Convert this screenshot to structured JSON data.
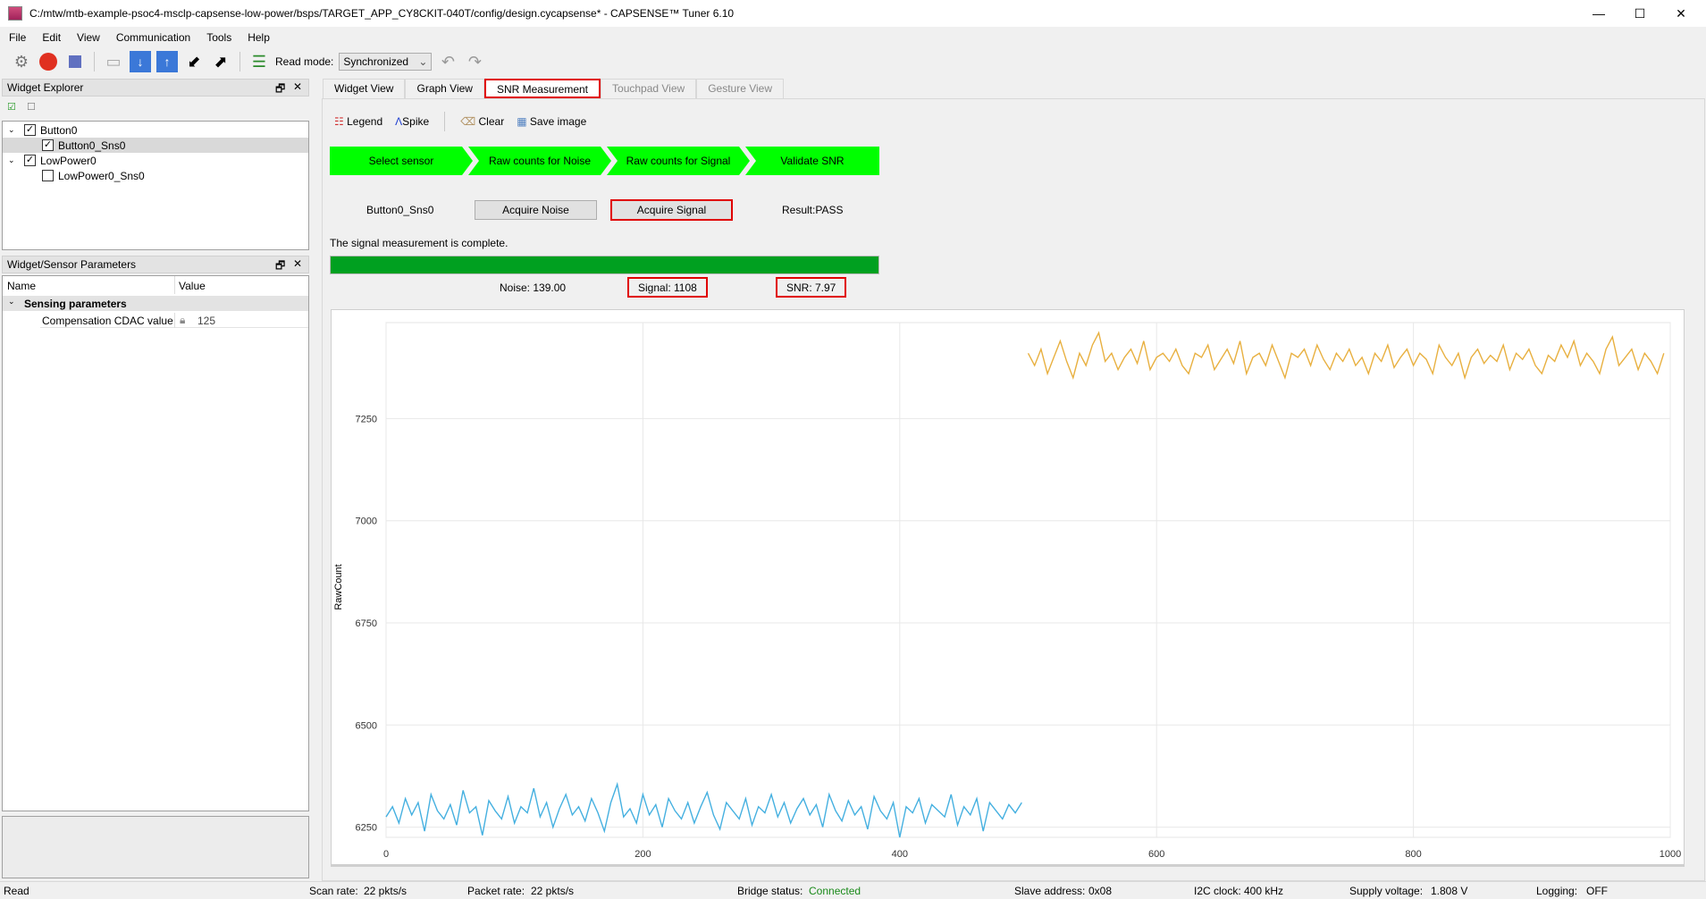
{
  "window": {
    "title": "C:/mtw/mtb-example-psoc4-msclp-capsense-low-power/bsps/TARGET_APP_CY8CKIT-040T/config/design.cycapsense* - CAPSENSE™ Tuner 6.10",
    "minimize": "—",
    "maximize": "☐",
    "close": "✕"
  },
  "menu": [
    "File",
    "Edit",
    "View",
    "Communication",
    "Tools",
    "Help"
  ],
  "toolbar": {
    "read_mode_label": "Read mode:",
    "read_mode_value": "Synchronized",
    "icons": [
      "gear-icon",
      "disconnect-icon",
      "stop-icon",
      "open-icon",
      "download-icon",
      "upload-icon",
      "import-icon",
      "export-icon",
      "log-icon",
      "undo-icon",
      "redo-icon"
    ]
  },
  "widget_explorer": {
    "title": "Widget Explorer",
    "tree": [
      {
        "label": "Button0",
        "checked": true,
        "level": 0
      },
      {
        "label": "Button0_Sns0",
        "checked": true,
        "level": 1,
        "selected": true
      },
      {
        "label": "LowPower0",
        "checked": true,
        "level": 0
      },
      {
        "label": "LowPower0_Sns0",
        "checked": false,
        "level": 1
      }
    ]
  },
  "params": {
    "title": "Widget/Sensor Parameters",
    "col_name": "Name",
    "col_value": "Value",
    "group": "Sensing parameters",
    "row_name": "Compensation CDAC value",
    "row_value": "125"
  },
  "tabs": [
    {
      "label": "Widget View"
    },
    {
      "label": "Graph View"
    },
    {
      "label": "SNR Measurement",
      "selected": true
    },
    {
      "label": "Touchpad View",
      "disabled": true
    },
    {
      "label": "Gesture View",
      "disabled": true
    }
  ],
  "snr_toolbar": {
    "legend": "Legend",
    "spike": "Spike",
    "clear": "Clear",
    "save_image": "Save image"
  },
  "steps": [
    "Select sensor",
    "Raw counts for Noise",
    "Raw counts for Signal",
    "Validate SNR"
  ],
  "sensor": "Button0_Sns0",
  "acquire_noise": "Acquire Noise",
  "acquire_signal": "Acquire Signal",
  "result": "Result:PASS",
  "message": "The signal measurement is complete.",
  "progress": 100,
  "noise": "Noise:  139.00",
  "signal": "Signal:  1108",
  "snr": "SNR:  7.97",
  "colors": {
    "step": "#00ff00",
    "progress": "#00a020",
    "noise_series": "#45b0e0",
    "signal_series": "#e8b040",
    "highlight": "#e00000"
  },
  "chart_data": {
    "type": "line",
    "ylabel": "RawCount",
    "xlim": [
      0,
      1000
    ],
    "ylim": [
      6225,
      7485
    ],
    "grid": true,
    "xticks": [
      "0",
      "200",
      "400",
      "600",
      "800",
      "1000"
    ],
    "yticks": [
      "6250",
      "6500",
      "6750",
      "7000",
      "7250"
    ],
    "series": [
      {
        "x_start": 0,
        "x_step": 5,
        "values": [
          6275,
          6300,
          6260,
          6320,
          6280,
          6310,
          6240,
          6330,
          6290,
          6270,
          6305,
          6255,
          6340,
          6285,
          6300,
          6230,
          6315,
          6290,
          6270,
          6325,
          6260,
          6300,
          6285,
          6345,
          6275,
          6310,
          6250,
          6295,
          6330,
          6280,
          6300,
          6265,
          6320,
          6285,
          6240,
          6310,
          6355,
          6275,
          6295,
          6260,
          6330,
          6280,
          6305,
          6250,
          6320,
          6290,
          6270,
          6310,
          6260,
          6300,
          6335,
          6280,
          6245,
          6310,
          6290,
          6270,
          6320,
          6255,
          6300,
          6285,
          6330,
          6275,
          6310,
          6260,
          6295,
          6320,
          6280,
          6305,
          6250,
          6330,
          6290,
          6265,
          6315,
          6280,
          6300,
          6245,
          6325,
          6290,
          6270,
          6310,
          6225,
          6300,
          6285,
          6320,
          6260,
          6305,
          6290,
          6275,
          6330,
          6255,
          6300,
          6280,
          6320,
          6240,
          6310,
          6290,
          6270,
          6305,
          6285,
          6310
        ]
      },
      {
        "x_start": 500,
        "x_step": 5,
        "values": [
          7410,
          7380,
          7420,
          7360,
          7400,
          7440,
          7390,
          7350,
          7410,
          7380,
          7430,
          7460,
          7390,
          7410,
          7370,
          7400,
          7420,
          7385,
          7440,
          7370,
          7400,
          7410,
          7390,
          7420,
          7380,
          7360,
          7410,
          7400,
          7430,
          7370,
          7395,
          7420,
          7385,
          7440,
          7360,
          7400,
          7410,
          7380,
          7430,
          7390,
          7350,
          7410,
          7400,
          7420,
          7380,
          7430,
          7395,
          7370,
          7410,
          7390,
          7420,
          7380,
          7400,
          7360,
          7410,
          7390,
          7430,
          7375,
          7400,
          7420,
          7380,
          7410,
          7395,
          7360,
          7430,
          7400,
          7380,
          7410,
          7350,
          7400,
          7420,
          7385,
          7405,
          7390,
          7430,
          7370,
          7410,
          7395,
          7420,
          7380,
          7360,
          7405,
          7390,
          7430,
          7400,
          7440,
          7380,
          7410,
          7390,
          7360,
          7420,
          7450,
          7380,
          7400,
          7420,
          7370,
          7410,
          7390,
          7360,
          7410
        ]
      }
    ]
  },
  "status": {
    "read": "Read",
    "scan_rate_label": "Scan rate:",
    "scan_rate": "22 pkts/s",
    "packet_rate_label": "Packet rate:",
    "packet_rate": "22 pkts/s",
    "bridge_label": "Bridge status:",
    "bridge": "Connected",
    "slave_label": "Slave address:",
    "slave": "0x08",
    "i2c_label": "I2C clock:",
    "i2c": "400 kHz",
    "supply_label": "Supply voltage:",
    "supply": "1.808 V",
    "logging_label": "Logging:",
    "logging": "OFF"
  }
}
